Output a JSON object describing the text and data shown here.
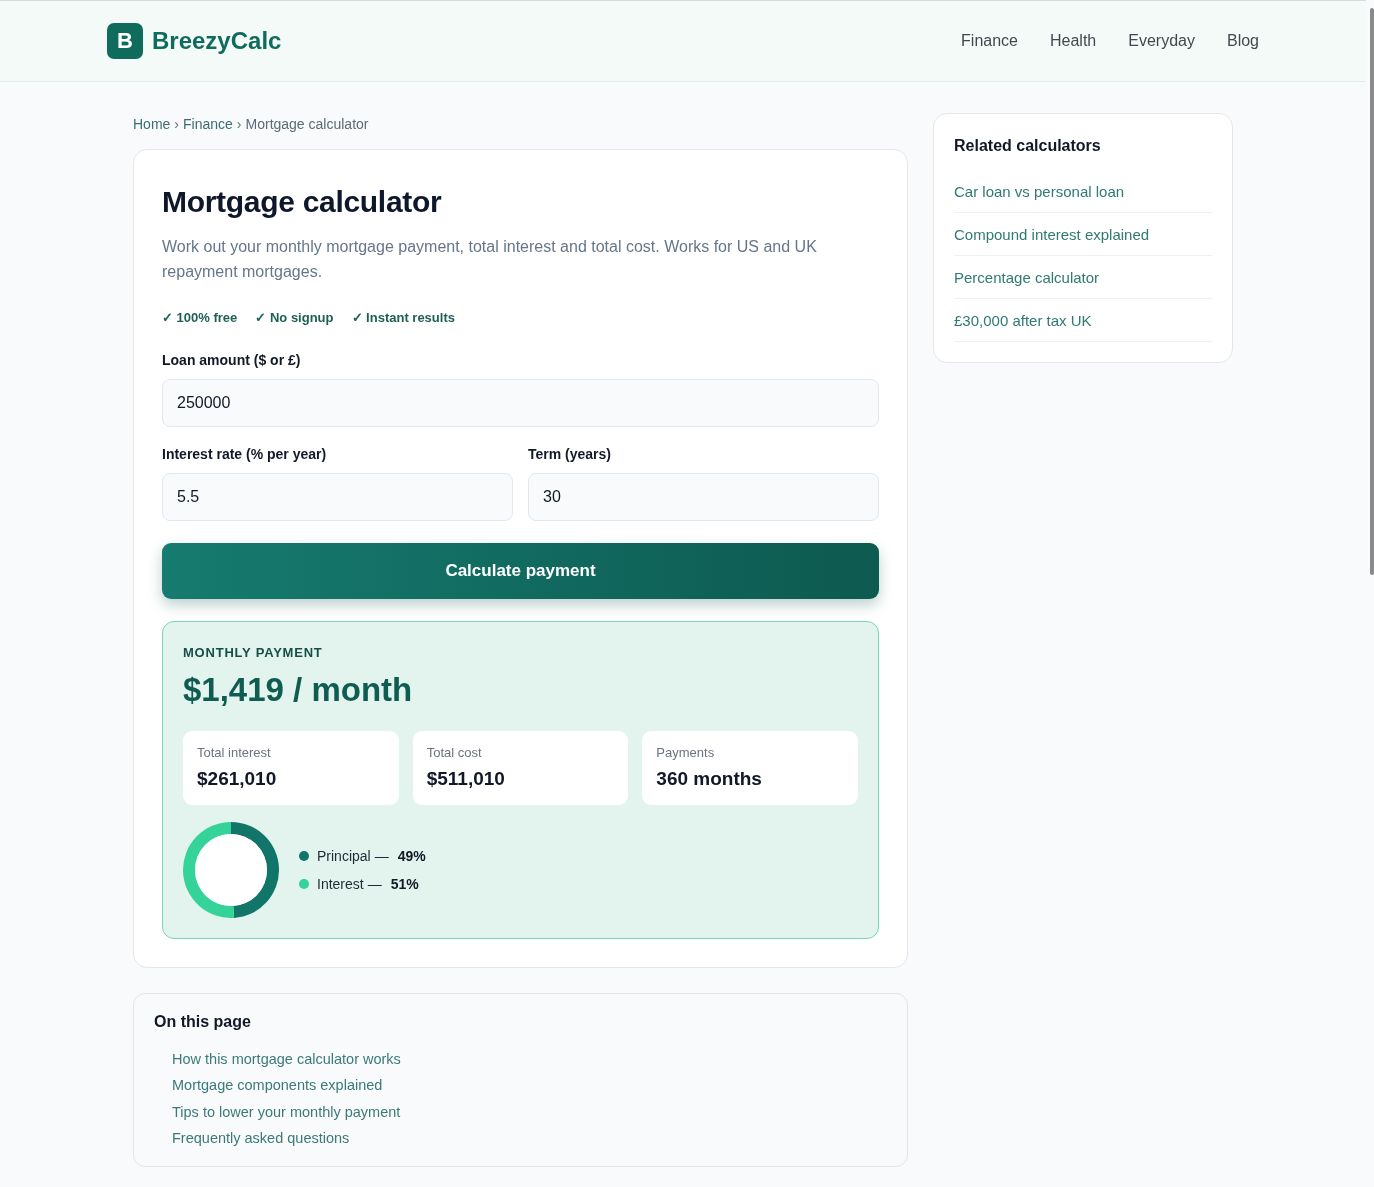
{
  "header": {
    "logo": {
      "mark": "B",
      "name": "BreezyCalc"
    },
    "nav": [
      "Finance",
      "Health",
      "Everyday",
      "Blog"
    ]
  },
  "breadcrumb": [
    {
      "kind": "link",
      "text": "Home"
    },
    {
      "kind": "separator",
      "text": "›"
    },
    {
      "kind": "link",
      "text": "Finance"
    },
    {
      "kind": "separator",
      "text": "›"
    },
    {
      "kind": "current",
      "text": "Mortgage calculator"
    }
  ],
  "calculator": {
    "title": "Mortgage calculator",
    "description": "Work out your monthly mortgage payment, total interest and total cost. Works for US and UK repayment mortgages.",
    "badges": [
      "✓ 100% free",
      "✓ No signup",
      "✓ Instant results"
    ],
    "field_rows": [
      [
        {
          "label": "Loan amount ($ or £)",
          "value": "250000"
        }
      ],
      [
        {
          "label": "Interest rate (% per year)",
          "value": "5.5"
        },
        {
          "label": "Term (years)",
          "value": "30"
        }
      ]
    ],
    "button": "Calculate payment",
    "result": {
      "heading": "MONTHLY PAYMENT",
      "amount": "$1,419 / month",
      "stats": [
        {
          "label": "Total interest",
          "value": "$261,010"
        },
        {
          "label": "Total cost",
          "value": "$511,010"
        },
        {
          "label": "Payments",
          "value": "360 months"
        }
      ],
      "chart_data": {
        "type": "donut",
        "categories": [
          "Principal",
          "Interest"
        ],
        "values": [
          49,
          51
        ]
      },
      "legend": [
        {
          "dash": "—",
          "value": "49%",
          "color": "#12756a"
        },
        {
          "dash": "—",
          "value": "51%",
          "color": "#34d399"
        }
      ]
    }
  },
  "on_this_page": {
    "title": "On this page",
    "links": [
      "How this mortgage calculator works",
      "Mortgage components explained",
      "Tips to lower your monthly payment",
      "Frequently asked questions"
    ]
  },
  "sidebar": {
    "title": "Related calculators",
    "links": [
      "Car loan vs personal loan",
      "Compound interest explained",
      "Percentage calculator",
      "£30,000 after tax UK"
    ]
  }
}
